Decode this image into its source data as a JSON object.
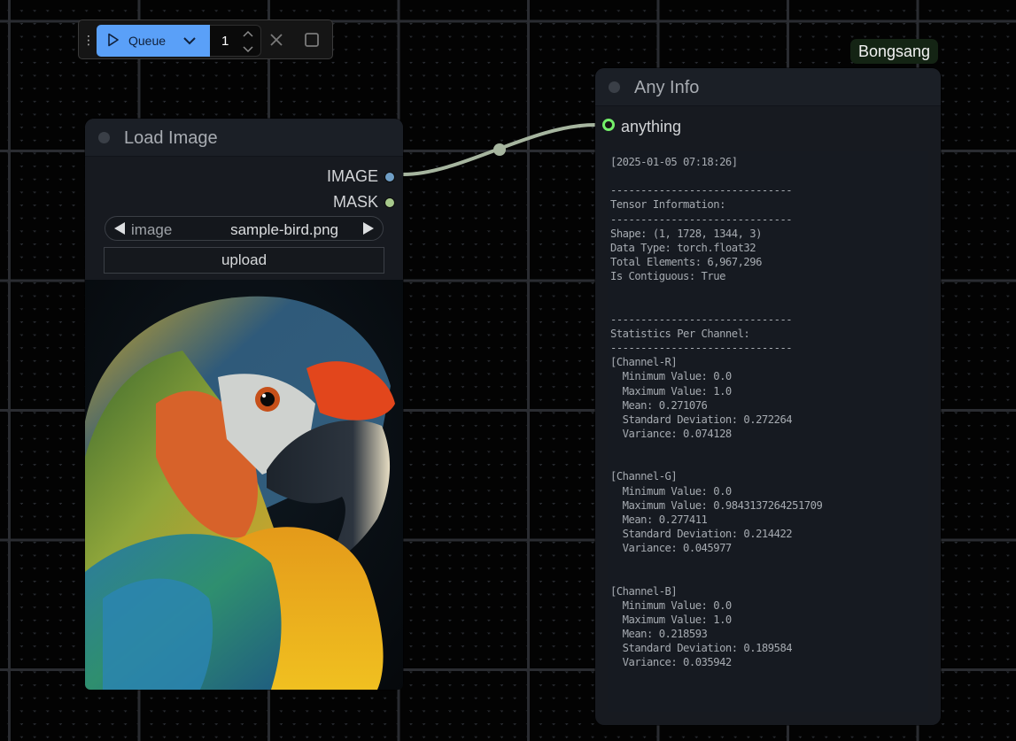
{
  "toolbar": {
    "drag_handle_icon": "vertical-dots-icon",
    "queue_label": "Queue",
    "queue_icon": "play-icon",
    "queue_mode_icon": "chevron-down-icon",
    "batch_count": "1",
    "cancel_icon": "x-icon",
    "stop_icon": "square-icon",
    "accent_color": "#5aa0f8"
  },
  "nodes": {
    "load_image": {
      "title": "Load Image",
      "outputs": [
        {
          "label": "IMAGE",
          "color": "#6f9ec6"
        },
        {
          "label": "MASK",
          "color": "#8fbf7a"
        }
      ],
      "widget": {
        "name": "image",
        "value": "sample-bird.png"
      },
      "upload_label": "upload",
      "preview_alt": "Colorful macaw parrot portrait"
    },
    "any_info": {
      "title": "Any Info",
      "input": {
        "label": "anything",
        "color": "#74f06a"
      },
      "output_lines": [
        "[2025-01-05 07:18:26]",
        "",
        "------------------------------",
        "Tensor Information:",
        "------------------------------",
        "Shape: (1, 1728, 1344, 3)",
        "Data Type: torch.float32",
        "Total Elements: 6,967,296",
        "Is Contiguous: True",
        "",
        "",
        "------------------------------",
        "Statistics Per Channel:",
        "------------------------------",
        "[Channel-R]",
        "  Minimum Value: 0.0",
        "  Maximum Value: 1.0",
        "  Mean: 0.271076",
        "  Standard Deviation: 0.272264",
        "  Variance: 0.074128",
        "",
        "",
        "[Channel-G]",
        "  Minimum Value: 0.0",
        "  Maximum Value: 0.9843137264251709",
        "  Mean: 0.277411",
        "  Standard Deviation: 0.214422",
        "  Variance: 0.045977",
        "",
        "",
        "[Channel-B]",
        "  Minimum Value: 0.0",
        "  Maximum Value: 1.0",
        "  Mean: 0.218593",
        "  Standard Deviation: 0.189584",
        "  Variance: 0.035942"
      ],
      "badge": "Bongsang"
    }
  },
  "link": {
    "from": "IMAGE",
    "to": "anything",
    "color": "#a8b8a0"
  }
}
